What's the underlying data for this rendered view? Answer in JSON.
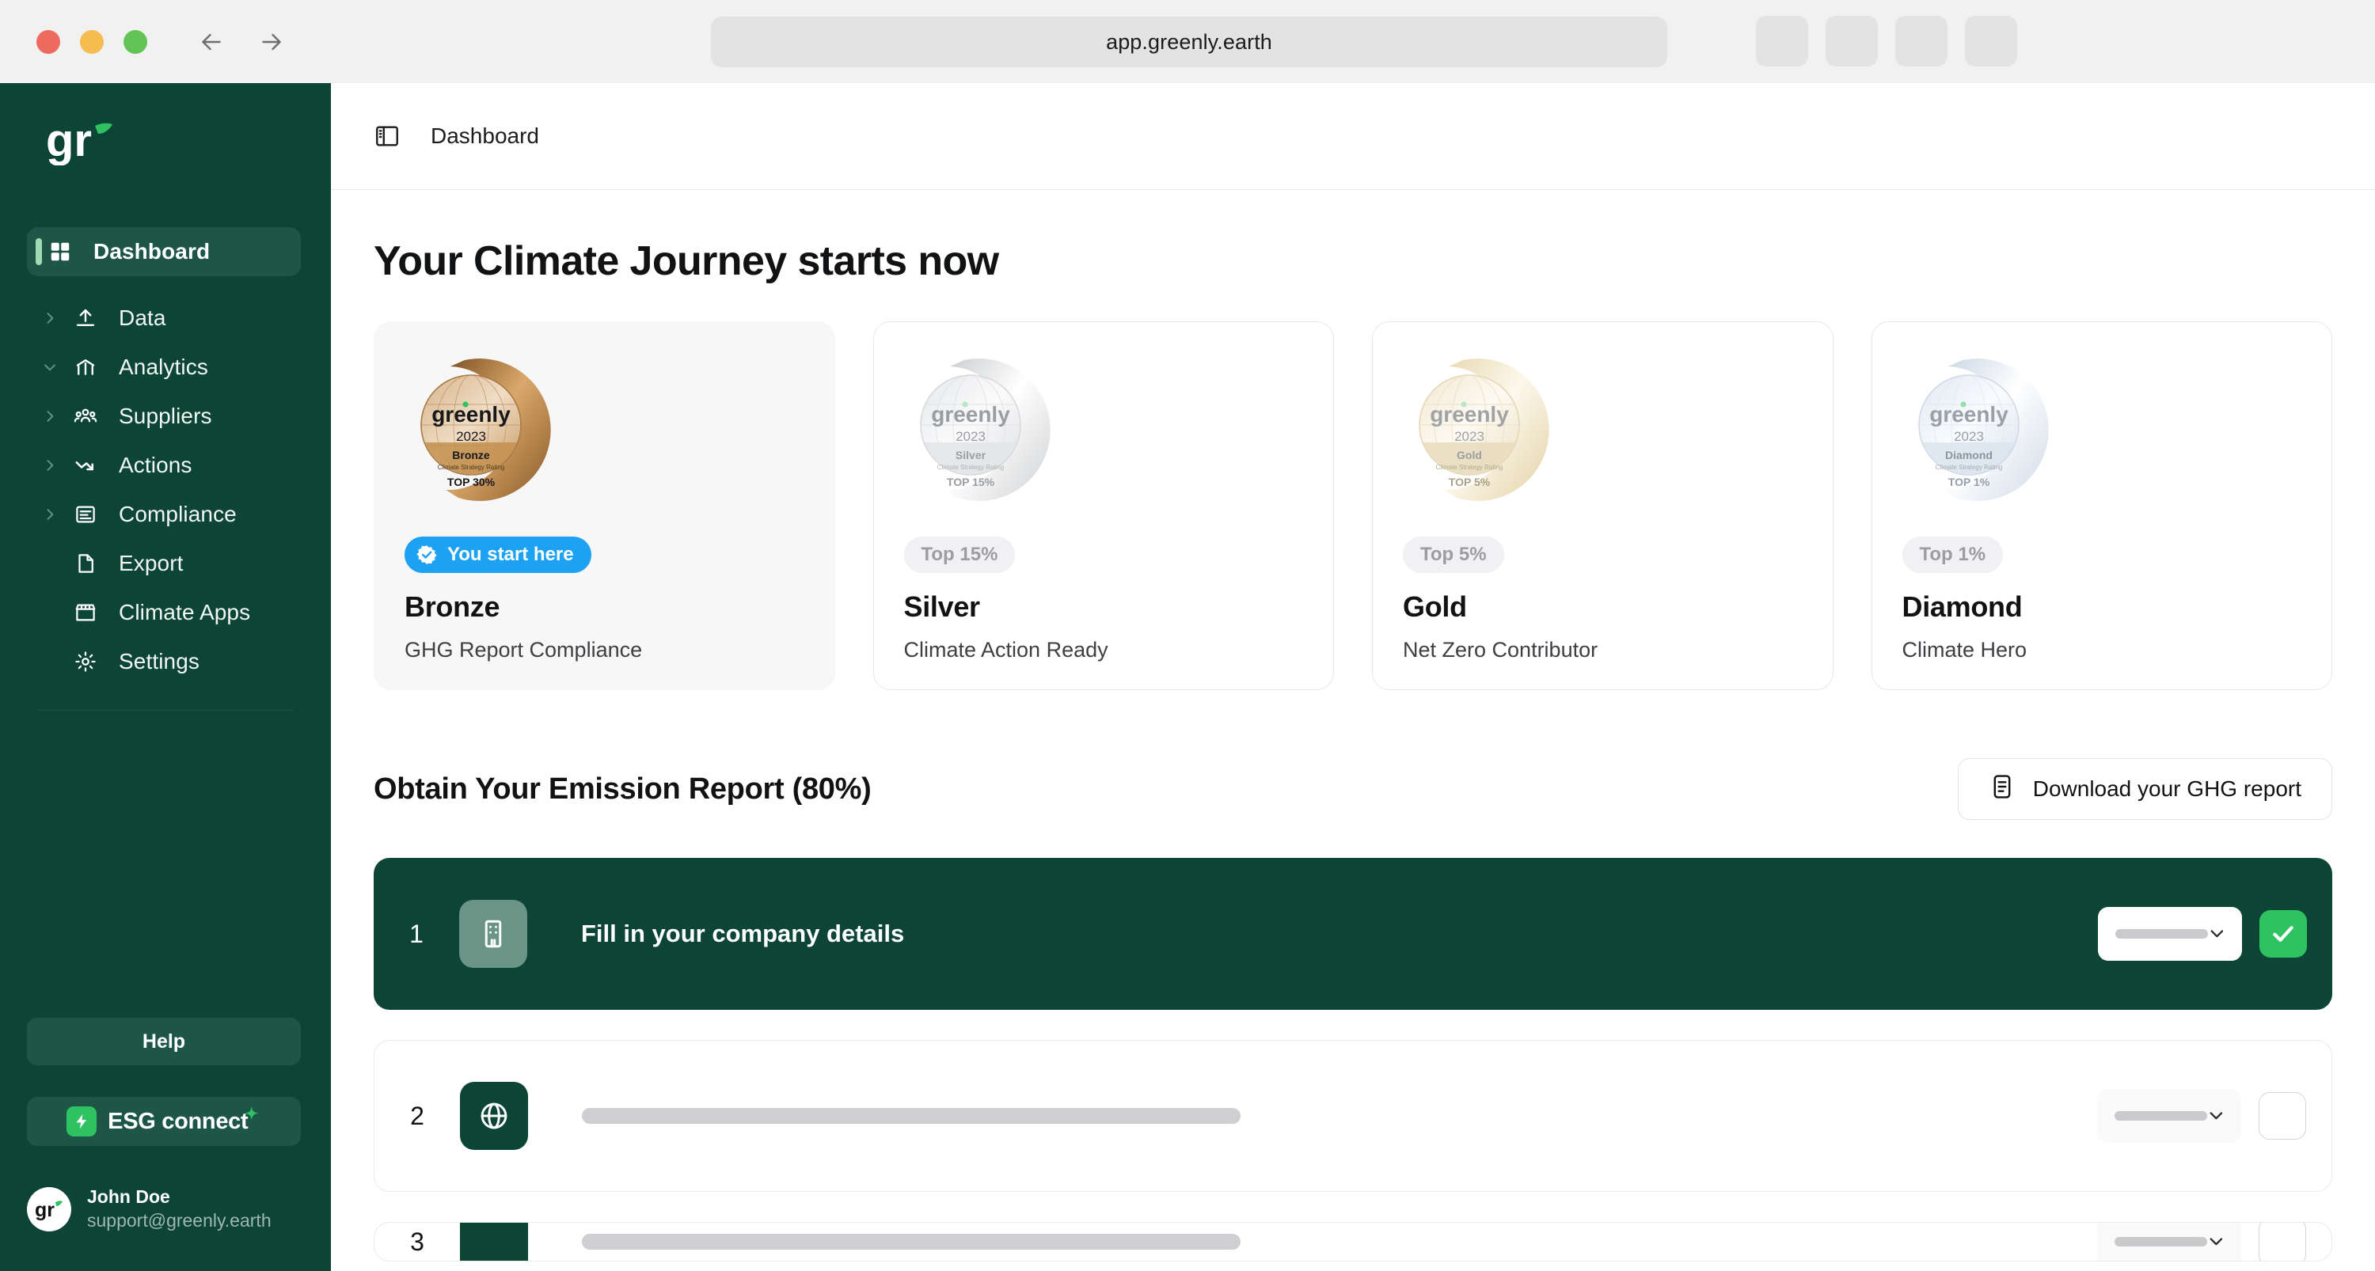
{
  "browser": {
    "url": "app.greenly.earth",
    "traffic_lights": [
      "close-red",
      "minimize-yellow",
      "maximize-green"
    ],
    "back_icon": "arrow-left-icon",
    "forward_icon": "arrow-right-icon",
    "tool_buttons": [
      "tool-1",
      "tool-2",
      "tool-3",
      "tool-4"
    ]
  },
  "sidebar": {
    "logo_alt": "greenly-logo",
    "items": [
      {
        "label": "Dashboard",
        "icon": "grid-icon",
        "active": true,
        "expandable": false
      },
      {
        "label": "Data",
        "icon": "upload-icon",
        "active": false,
        "expandable": true
      },
      {
        "label": "Analytics",
        "icon": "analytics-icon",
        "active": false,
        "expandable": true
      },
      {
        "label": "Suppliers",
        "icon": "users-icon",
        "active": false,
        "expandable": true
      },
      {
        "label": "Actions",
        "icon": "trend-down-icon",
        "active": false,
        "expandable": true
      },
      {
        "label": "Compliance",
        "icon": "document-icon",
        "active": false,
        "expandable": true
      },
      {
        "label": "Export",
        "icon": "file-icon",
        "active": false,
        "expandable": false
      },
      {
        "label": "Climate Apps",
        "icon": "store-icon",
        "active": false,
        "expandable": false
      },
      {
        "label": "Settings",
        "icon": "gear-icon",
        "active": false,
        "expandable": false
      }
    ],
    "help_label": "Help",
    "esg_label": "ESG connect",
    "user": {
      "name": "John Doe",
      "email": "support@greenly.earth"
    }
  },
  "topbar": {
    "panel_toggle_icon": "panel-left-icon",
    "breadcrumb": "Dashboard"
  },
  "main": {
    "page_title": "Your Climate Journey starts now",
    "cards": [
      {
        "name": "Bronze",
        "description": "GHG Report Compliance",
        "badge_label": "You start here",
        "badge_type": "start",
        "medal": {
          "brand": "greenly",
          "year": "2023",
          "tier": "Bronze",
          "rating_text": "Climate Strategy Rating",
          "top_text": "TOP 30%",
          "color": "#b07c3f",
          "color_light": "#e3c49b"
        },
        "highlight": true
      },
      {
        "name": "Silver",
        "description": "Climate Action Ready",
        "badge_label": "Top 15%",
        "badge_type": "rank",
        "medal": {
          "brand": "greenly",
          "year": "2023",
          "tier": "Silver",
          "rating_text": "Climate Strategy Rating",
          "top_text": "TOP 15%",
          "color": "#d6d8da",
          "color_light": "#f2f3f4"
        },
        "highlight": false
      },
      {
        "name": "Gold",
        "description": "Net Zero Contributor",
        "badge_label": "Top 5%",
        "badge_type": "rank",
        "medal": {
          "brand": "greenly",
          "year": "2023",
          "tier": "Gold",
          "rating_text": "Climate Strategy Rating",
          "top_text": "TOP 5%",
          "color": "#e7d7ae",
          "color_light": "#faf4e4"
        },
        "highlight": false
      },
      {
        "name": "Diamond",
        "description": "Climate Hero",
        "badge_label": "Top 1%",
        "badge_type": "rank",
        "medal": {
          "brand": "greenly",
          "year": "2023",
          "tier": "Diamond",
          "rating_text": "Climate Strategy Rating",
          "top_text": "TOP 1%",
          "color": "#ccd8e4",
          "color_light": "#eef3f8"
        },
        "highlight": false
      }
    ],
    "report": {
      "title": "Obtain Your Emission Report (80%)",
      "progress_percent": 80,
      "download_label": "Download your GHG report",
      "download_icon": "report-icon"
    },
    "steps": [
      {
        "number": "1",
        "label": "Fill in your company details",
        "icon": "building-icon",
        "state": "active",
        "completed": true,
        "select_value": ""
      },
      {
        "number": "2",
        "label": "",
        "icon": "globe-icon",
        "state": "idle",
        "completed": false,
        "select_value": ""
      },
      {
        "number": "3",
        "label": "",
        "icon": "placeholder-icon",
        "state": "idle",
        "completed": false,
        "select_value": ""
      }
    ]
  },
  "colors": {
    "brand_dark_green": "#0c4536",
    "brand_green": "#2fc261",
    "accent_blue": "#1da1f2",
    "sidebar_active": "#1d5546",
    "accent_mint": "#9fdcb6"
  }
}
